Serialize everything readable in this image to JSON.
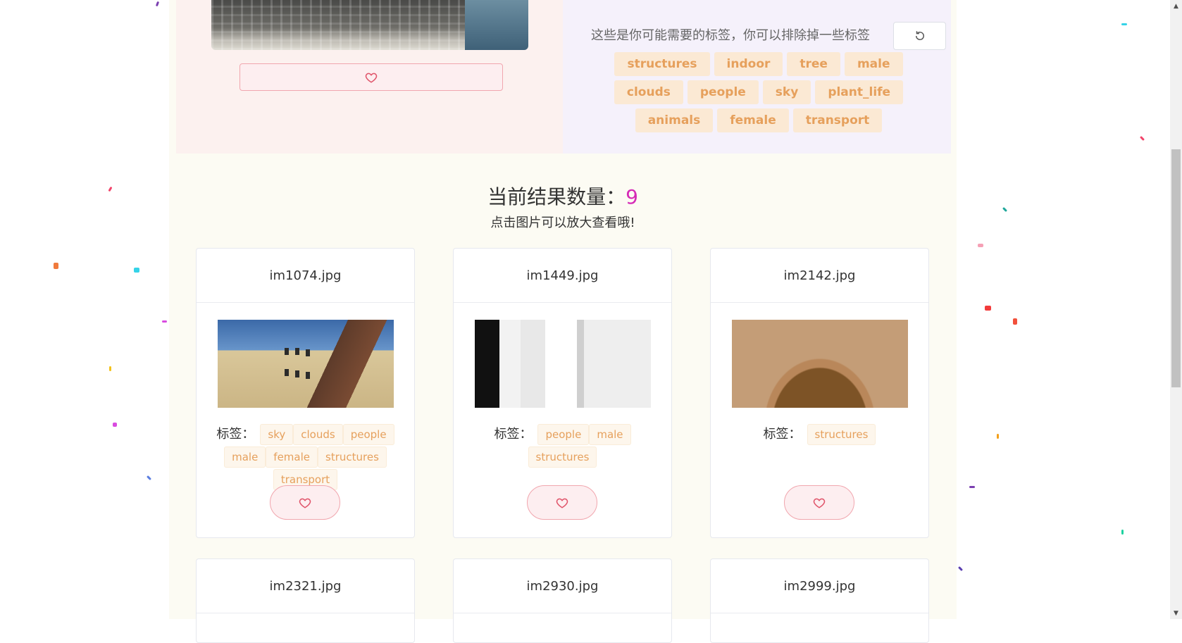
{
  "top_section": {
    "tag_hint": "这些是你可能需要的标签，你可以排除掉一些标签",
    "reset_icon": "refresh-icon",
    "favorite_icon": "heart-icon",
    "tags": [
      "structures",
      "indoor",
      "tree",
      "male",
      "clouds",
      "people",
      "sky",
      "plant_life",
      "animals",
      "female",
      "transport"
    ]
  },
  "results": {
    "title_prefix": "当前结果数量：",
    "count": "9",
    "subtitle": "点击图片可以放大查看哦!"
  },
  "cards": [
    {
      "filename": "im1074.jpg",
      "tag_label": "标签：",
      "tags": [
        "sky",
        "clouds",
        "people",
        "male",
        "female",
        "structures",
        "transport"
      ]
    },
    {
      "filename": "im1449.jpg",
      "tag_label": "标签：",
      "tags": [
        "people",
        "male",
        "structures"
      ]
    },
    {
      "filename": "im2142.jpg",
      "tag_label": "标签：",
      "tags": [
        "structures"
      ]
    },
    {
      "filename": "im2321.jpg"
    },
    {
      "filename": "im2930.jpg"
    },
    {
      "filename": "im2999.jpg"
    }
  ],
  "colors": {
    "accent_count": "#d52ab6",
    "tag_text": "#e6a05c",
    "favorite": "#e0546a"
  }
}
